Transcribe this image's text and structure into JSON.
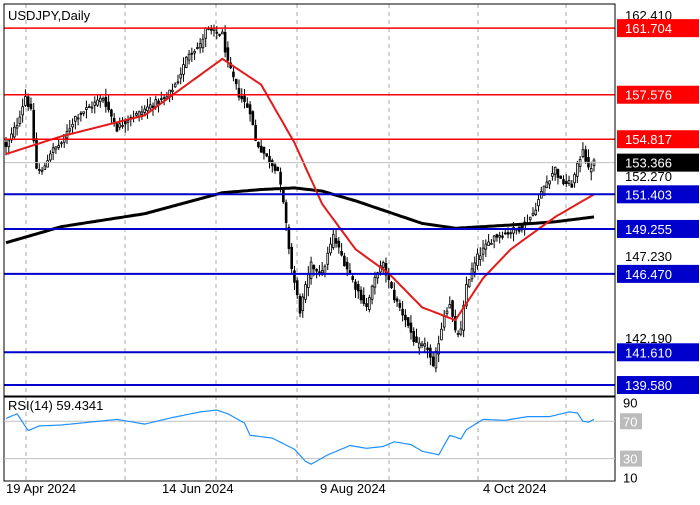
{
  "symbol_title": "USDJPY,Daily",
  "rsi": {
    "label": "RSI(14) 59.4341",
    "levels": [
      70,
      30
    ],
    "axis_labels": [
      "90",
      "70",
      "30",
      "10"
    ]
  },
  "price_axis": {
    "tick_labels": [
      "162.410",
      "152.270",
      "147.230",
      "142.190"
    ]
  },
  "x_axis": {
    "tick_labels": [
      "19 Apr 2024",
      "14 Jun 2024",
      "9 Aug 2024",
      "4 Oct 2024"
    ]
  },
  "levels": {
    "red": [
      {
        "value": 161.704,
        "label": "161.704"
      },
      {
        "value": 157.576,
        "label": "157.576"
      },
      {
        "value": 154.817,
        "label": "154.817"
      }
    ],
    "blue": [
      {
        "value": 151.403,
        "label": "151.403"
      },
      {
        "value": 149.255,
        "label": "149.255"
      },
      {
        "value": 146.47,
        "label": "146.470"
      },
      {
        "value": 141.61,
        "label": "141.610"
      },
      {
        "value": 139.58,
        "label": "139.580"
      }
    ]
  },
  "current_price": {
    "value": 153.366,
    "label": "153.366"
  },
  "colors": {
    "red_level": "#ff0000",
    "blue_level": "#0000cc",
    "current_price_bg": "#000000",
    "fast_ma": "#e31a1a",
    "slow_ma": "#000000",
    "rsi_line": "#1e90ff",
    "grid": "#aaaaaa",
    "candle": "#000000"
  },
  "chart_data": {
    "type": "candlestick",
    "symbol": "USDJPY",
    "timeframe": "Daily",
    "ylim": [
      138.9,
      163.2
    ],
    "series": [
      {
        "name": "price",
        "type": "candlestick"
      },
      {
        "name": "moving-average-fast",
        "type": "line",
        "anchors": [
          [
            0,
            153.9
          ],
          [
            20,
            155.0
          ],
          [
            50,
            156.3
          ],
          [
            78,
            159.8
          ],
          [
            92,
            158.2
          ],
          [
            104,
            154.6
          ],
          [
            114,
            150.8
          ],
          [
            126,
            148.0
          ],
          [
            138,
            146.5
          ],
          [
            150,
            144.4
          ],
          [
            162,
            143.6
          ],
          [
            172,
            146.2
          ],
          [
            182,
            148.0
          ],
          [
            198,
            150.0
          ],
          [
            212,
            151.4
          ]
        ]
      },
      {
        "name": "moving-average-slow",
        "type": "line",
        "anchors": [
          [
            0,
            148.4
          ],
          [
            20,
            149.4
          ],
          [
            50,
            150.2
          ],
          [
            78,
            151.5
          ],
          [
            92,
            151.7
          ],
          [
            104,
            151.8
          ],
          [
            114,
            151.6
          ],
          [
            126,
            151.0
          ],
          [
            138,
            150.3
          ],
          [
            150,
            149.6
          ],
          [
            162,
            149.3
          ],
          [
            172,
            149.4
          ],
          [
            182,
            149.5
          ],
          [
            198,
            149.7
          ],
          [
            212,
            150.0
          ]
        ]
      },
      {
        "name": "RSI(14)",
        "type": "line",
        "anchors": [
          [
            0,
            73
          ],
          [
            4,
            78
          ],
          [
            8,
            60
          ],
          [
            12,
            65
          ],
          [
            20,
            66
          ],
          [
            30,
            69
          ],
          [
            40,
            72
          ],
          [
            50,
            67
          ],
          [
            60,
            74
          ],
          [
            70,
            80
          ],
          [
            76,
            82
          ],
          [
            80,
            78
          ],
          [
            86,
            68
          ],
          [
            88,
            55
          ],
          [
            96,
            52
          ],
          [
            104,
            40
          ],
          [
            108,
            27
          ],
          [
            110,
            24
          ],
          [
            116,
            34
          ],
          [
            124,
            44
          ],
          [
            130,
            41
          ],
          [
            136,
            43
          ],
          [
            140,
            48
          ],
          [
            146,
            45
          ],
          [
            150,
            38
          ],
          [
            156,
            34
          ],
          [
            160,
            55
          ],
          [
            164,
            51
          ],
          [
            166,
            61
          ],
          [
            172,
            72
          ],
          [
            180,
            71
          ],
          [
            188,
            75
          ],
          [
            196,
            75
          ],
          [
            203,
            80
          ],
          [
            206,
            79
          ],
          [
            208,
            70
          ],
          [
            210,
            69
          ],
          [
            212,
            72
          ]
        ]
      }
    ],
    "ohlc_anchors": [
      [
        0,
        154.3
      ],
      [
        4,
        155.8
      ],
      [
        7,
        157.5
      ],
      [
        9,
        156.5
      ],
      [
        11,
        153.0
      ],
      [
        13,
        152.8
      ],
      [
        16,
        154.0
      ],
      [
        20,
        154.6
      ],
      [
        25,
        156.2
      ],
      [
        30,
        156.8
      ],
      [
        35,
        157.4
      ],
      [
        40,
        155.5
      ],
      [
        44,
        156.1
      ],
      [
        48,
        156.4
      ],
      [
        52,
        156.9
      ],
      [
        58,
        157.4
      ],
      [
        62,
        158.5
      ],
      [
        66,
        160.2
      ],
      [
        70,
        160.6
      ],
      [
        72,
        161.6
      ],
      [
        76,
        161.4
      ],
      [
        78,
        161.3
      ],
      [
        80,
        159.5
      ],
      [
        84,
        157.6
      ],
      [
        88,
        156.6
      ],
      [
        90,
        154.7
      ],
      [
        94,
        153.7
      ],
      [
        98,
        152.9
      ],
      [
        100,
        150.8
      ],
      [
        103,
        146.8
      ],
      [
        106,
        144.2
      ],
      [
        110,
        147.0
      ],
      [
        114,
        146.5
      ],
      [
        118,
        148.8
      ],
      [
        122,
        147.2
      ],
      [
        126,
        145.7
      ],
      [
        130,
        144.4
      ],
      [
        134,
        146.7
      ],
      [
        136,
        147.0
      ],
      [
        140,
        145.0
      ],
      [
        144,
        143.7
      ],
      [
        148,
        142.0
      ],
      [
        152,
        141.9
      ],
      [
        154,
        140.6
      ],
      [
        158,
        144.0
      ],
      [
        160,
        144.7
      ],
      [
        162,
        142.8
      ],
      [
        164,
        142.9
      ],
      [
        166,
        145.8
      ],
      [
        170,
        147.5
      ],
      [
        176,
        148.8
      ],
      [
        182,
        149.1
      ],
      [
        186,
        149.4
      ],
      [
        190,
        150.2
      ],
      [
        194,
        151.9
      ],
      [
        198,
        153.0
      ],
      [
        200,
        152.2
      ],
      [
        204,
        152.0
      ],
      [
        206,
        153.1
      ],
      [
        208,
        154.3
      ],
      [
        210,
        152.9
      ],
      [
        212,
        153.37
      ]
    ],
    "levels": [
      161.704,
      157.576,
      154.817,
      151.403,
      149.255,
      146.47,
      141.61,
      139.58
    ],
    "current_price": 153.366,
    "rsi_value": 59.4341,
    "x_tick_labels": [
      "19 Apr 2024",
      "14 Jun 2024",
      "9 Aug 2024",
      "4 Oct 2024"
    ],
    "y_tick_labels": [
      "162.410",
      "152.270",
      "147.230",
      "142.190"
    ],
    "grid": true
  }
}
